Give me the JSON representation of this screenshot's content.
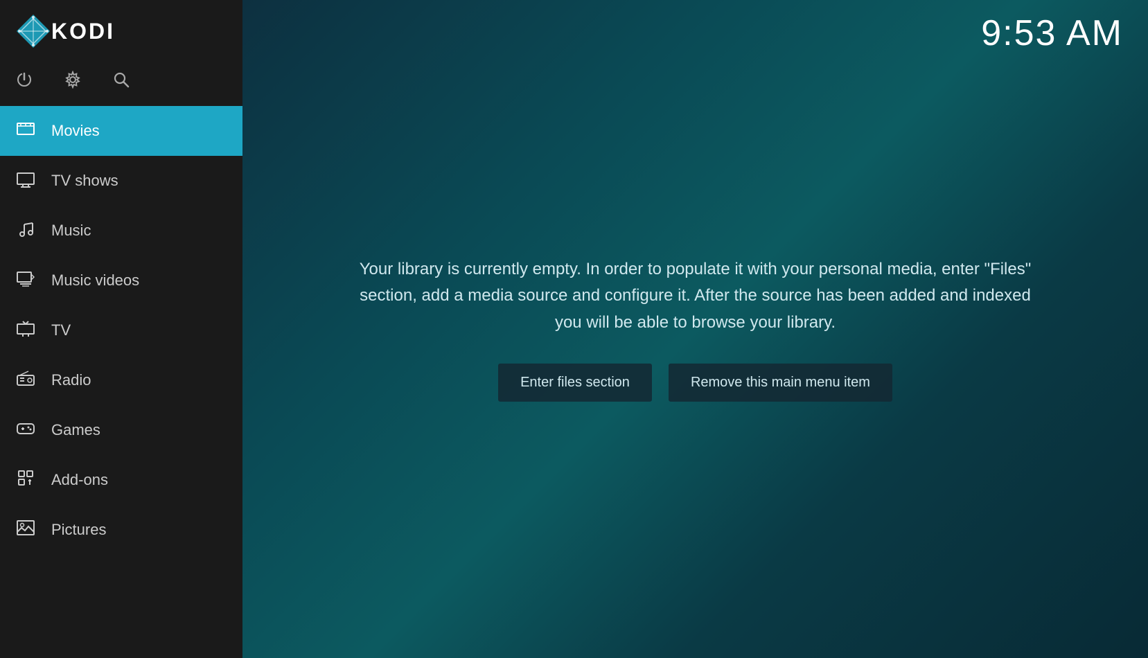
{
  "header": {
    "logo_text": "KODI",
    "clock": "9:53 AM"
  },
  "controls": [
    {
      "name": "power-icon",
      "symbol": "⏻"
    },
    {
      "name": "settings-icon",
      "symbol": "⚙"
    },
    {
      "name": "search-icon",
      "symbol": "🔍"
    }
  ],
  "nav": {
    "items": [
      {
        "id": "movies",
        "label": "Movies",
        "icon": "🎬",
        "active": true
      },
      {
        "id": "tv-shows",
        "label": "TV shows",
        "icon": "📺",
        "active": false
      },
      {
        "id": "music",
        "label": "Music",
        "icon": "🎧",
        "active": false
      },
      {
        "id": "music-videos",
        "label": "Music videos",
        "icon": "🎞",
        "active": false
      },
      {
        "id": "tv",
        "label": "TV",
        "icon": "📡",
        "active": false
      },
      {
        "id": "radio",
        "label": "Radio",
        "icon": "📻",
        "active": false
      },
      {
        "id": "games",
        "label": "Games",
        "icon": "🎮",
        "active": false
      },
      {
        "id": "add-ons",
        "label": "Add-ons",
        "icon": "📦",
        "active": false
      },
      {
        "id": "pictures",
        "label": "Pictures",
        "icon": "🖼",
        "active": false
      }
    ]
  },
  "main": {
    "library_message": "Your library is currently empty. In order to populate it with your personal media, enter \"Files\" section, add a media source and configure it. After the source has been added and indexed you will be able to browse your library.",
    "enter_files_label": "Enter files section",
    "remove_item_label": "Remove this main menu item"
  }
}
